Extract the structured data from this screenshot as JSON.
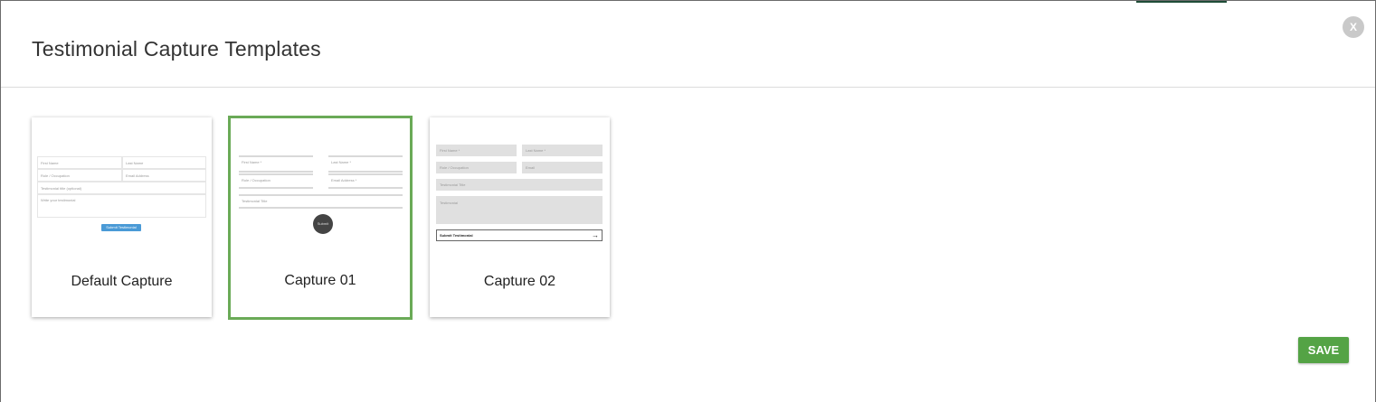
{
  "modal": {
    "title": "Testimonial Capture Templates",
    "close_label": "X",
    "save_label": "SAVE"
  },
  "colors": {
    "selected_border": "#6aaa57",
    "save_button": "#54a345",
    "default_submit": "#4a9ad6"
  },
  "templates": [
    {
      "label": "Default Capture",
      "selected": false,
      "fields": {
        "first_name": "First Name",
        "last_name": "Last Name",
        "role": "Role / Occupation",
        "email": "Email Address",
        "title": "Testimonial title (optional)",
        "message": "Write your testimonial",
        "submit": "Submit Testimonial"
      }
    },
    {
      "label": "Capture 01",
      "selected": true,
      "fields": {
        "first_name": "First Name *",
        "last_name": "Last Name *",
        "role": "Role / Occupation",
        "email": "Email Address *",
        "title": "Testimonial Title",
        "submit": "Submit"
      }
    },
    {
      "label": "Capture 02",
      "selected": false,
      "fields": {
        "first_name": "First Name *",
        "last_name": "Last Name *",
        "role": "Role / Occupation",
        "email": "Email",
        "title": "Testimonial Title",
        "message": "Testimonial",
        "submit": "Submit Testimonial"
      }
    }
  ]
}
